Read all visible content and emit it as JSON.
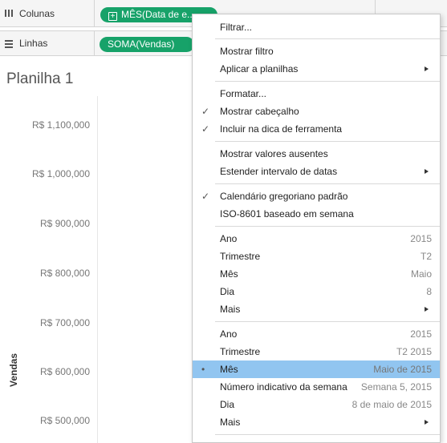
{
  "shelves": {
    "columns": {
      "label": "Colunas",
      "pill": "MÊS(Data de e...",
      "icon": "columns-icon"
    },
    "rows": {
      "label": "Linhas",
      "pill": "SOMA(Vendas)",
      "icon": "rows-icon"
    }
  },
  "sheet": {
    "title": "Planilha 1"
  },
  "axis": {
    "label": "Vendas",
    "ticks": [
      "R$ 1,100,000",
      "R$ 1,000,000",
      "R$ 900,000",
      "R$ 800,000",
      "R$ 700,000",
      "R$ 600,000",
      "R$ 500,000"
    ]
  },
  "menu": {
    "filter": "Filtrar...",
    "show_filter": "Mostrar filtro",
    "apply_to": "Aplicar a planilhas",
    "format": "Formatar...",
    "show_header": "Mostrar cabeçalho",
    "include_tooltip": "Incluir na dica de ferramenta",
    "show_missing": "Mostrar valores ausentes",
    "extend_range": "Estender intervalo de datas",
    "gregorian": "Calendário gregoriano padrão",
    "iso": "ISO-8601 baseado em semana",
    "discrete": [
      {
        "label": "Ano",
        "value": "2015"
      },
      {
        "label": "Trimestre",
        "value": "T2"
      },
      {
        "label": "Mês",
        "value": "Maio"
      },
      {
        "label": "Dia",
        "value": "8"
      },
      {
        "label": "Mais",
        "value": ""
      }
    ],
    "continuous": [
      {
        "label": "Ano",
        "value": "2015"
      },
      {
        "label": "Trimestre",
        "value": "T2 2015"
      },
      {
        "label": "Mês",
        "value": "Maio de 2015"
      },
      {
        "label": "Número indicativo da semana",
        "value": "Semana 5, 2015"
      },
      {
        "label": "Dia",
        "value": "8 de maio de 2015"
      },
      {
        "label": "Mais",
        "value": ""
      }
    ],
    "checkmark": "✓",
    "bullet": "•"
  }
}
